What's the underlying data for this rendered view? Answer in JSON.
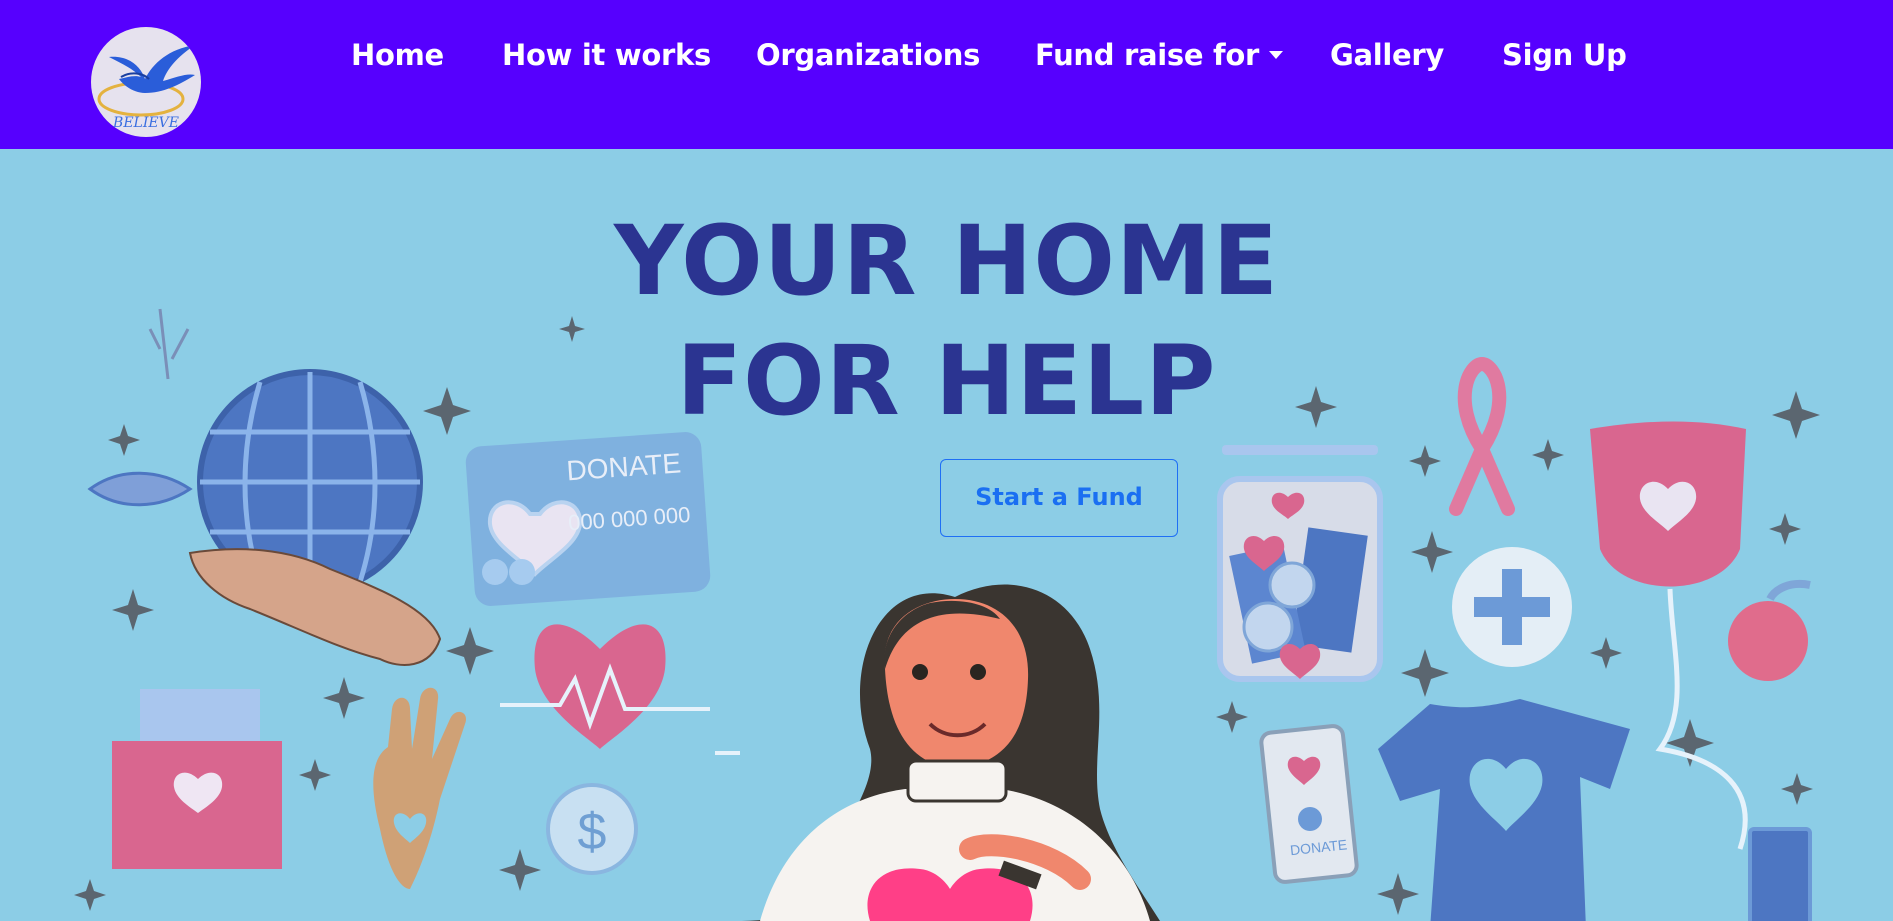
{
  "brand": {
    "logo_text": "BELIEVE",
    "logo_icon": "swallow-bird-icon"
  },
  "nav": {
    "items": [
      {
        "label": "Home"
      },
      {
        "label": "How it works"
      },
      {
        "label": "Organizations"
      },
      {
        "label": "Fund raise for",
        "has_dropdown": true
      },
      {
        "label": "Gallery"
      },
      {
        "label": "Sign Up"
      }
    ]
  },
  "hero": {
    "title_line1": "YOUR HOME",
    "title_line2": "FOR HELP",
    "cta_label": "Start a Fund",
    "card_text": "DONATE",
    "card_number": "000 000 000",
    "phone_text": "DONATE"
  },
  "colors": {
    "nav_background": "#5600fe",
    "hero_background": "#8ccde6",
    "title": "#2b3491",
    "cta": "#1a6ff2",
    "accent_pink": "#d9668f",
    "accent_blue": "#4d76c2"
  }
}
